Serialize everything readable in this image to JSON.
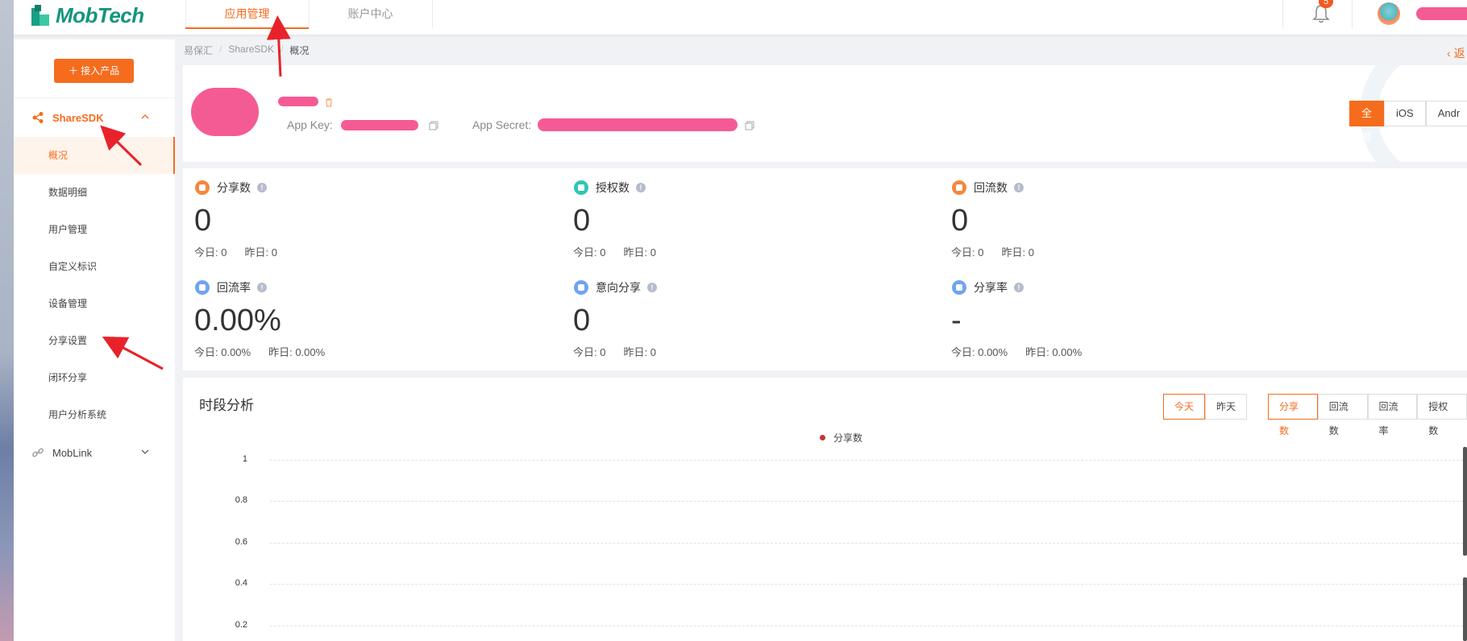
{
  "topbar": {
    "logo": "MobTech",
    "tabs": [
      "应用管理",
      "账户中心"
    ],
    "notification_count": "5"
  },
  "sidebar": {
    "add_button": "＋ 接入产品",
    "group_sharesdk": "ShareSDK",
    "items": [
      "概况",
      "数据明细",
      "用户管理",
      "自定义标识",
      "设备管理",
      "分享设置",
      "闭环分享",
      "用户分析系统"
    ],
    "group_moblink": "MobLink"
  },
  "breadcrumb": [
    "易保汇",
    "ShareSDK",
    "概况"
  ],
  "back_label": "返",
  "app": {
    "app_key_label": "App Key:",
    "app_secret_label": "App Secret:",
    "platforms": [
      "全部",
      "iOS",
      "Andr"
    ]
  },
  "stats": [
    {
      "title": "分享数",
      "value": "0",
      "today": "今日:  0",
      "yesterday": "昨日:  0",
      "color": "#f5873c"
    },
    {
      "title": "授权数",
      "value": "0",
      "today": "今日:  0",
      "yesterday": "昨日:  0",
      "color": "#2ec7b2"
    },
    {
      "title": "回流数",
      "value": "0",
      "today": "今日:  0",
      "yesterday": "昨日:  0",
      "color": "#f5873c"
    },
    {
      "title": "回流率",
      "value": "0.00%",
      "today": "今日:  0.00%",
      "yesterday": "昨日:  0.00%",
      "color": "#6fa4ef"
    },
    {
      "title": "意向分享",
      "value": "0",
      "today": "今日:  0",
      "yesterday": "昨日:  0",
      "color": "#6fa4ef"
    },
    {
      "title": "分享率",
      "value": "-",
      "today": "今日:  0.00%",
      "yesterday": "昨日:  0.00%",
      "color": "#6fa4ef"
    }
  ],
  "trend": {
    "title": "时段分析",
    "day_tabs": [
      "今天",
      "昨天"
    ],
    "metric_tabs": [
      "分享数",
      "回流数",
      "回流率",
      "授权数"
    ],
    "legend": "分享数",
    "y_ticks": [
      "1",
      "0.8",
      "0.6",
      "0.4",
      "0.2"
    ]
  },
  "chart_data": {
    "type": "line",
    "series": [
      {
        "name": "分享数",
        "values": []
      }
    ],
    "yticks": [
      1,
      0.8,
      0.6,
      0.4,
      0.2
    ],
    "ylim": [
      0,
      1
    ],
    "legend_position": "top-center",
    "grid": true
  }
}
